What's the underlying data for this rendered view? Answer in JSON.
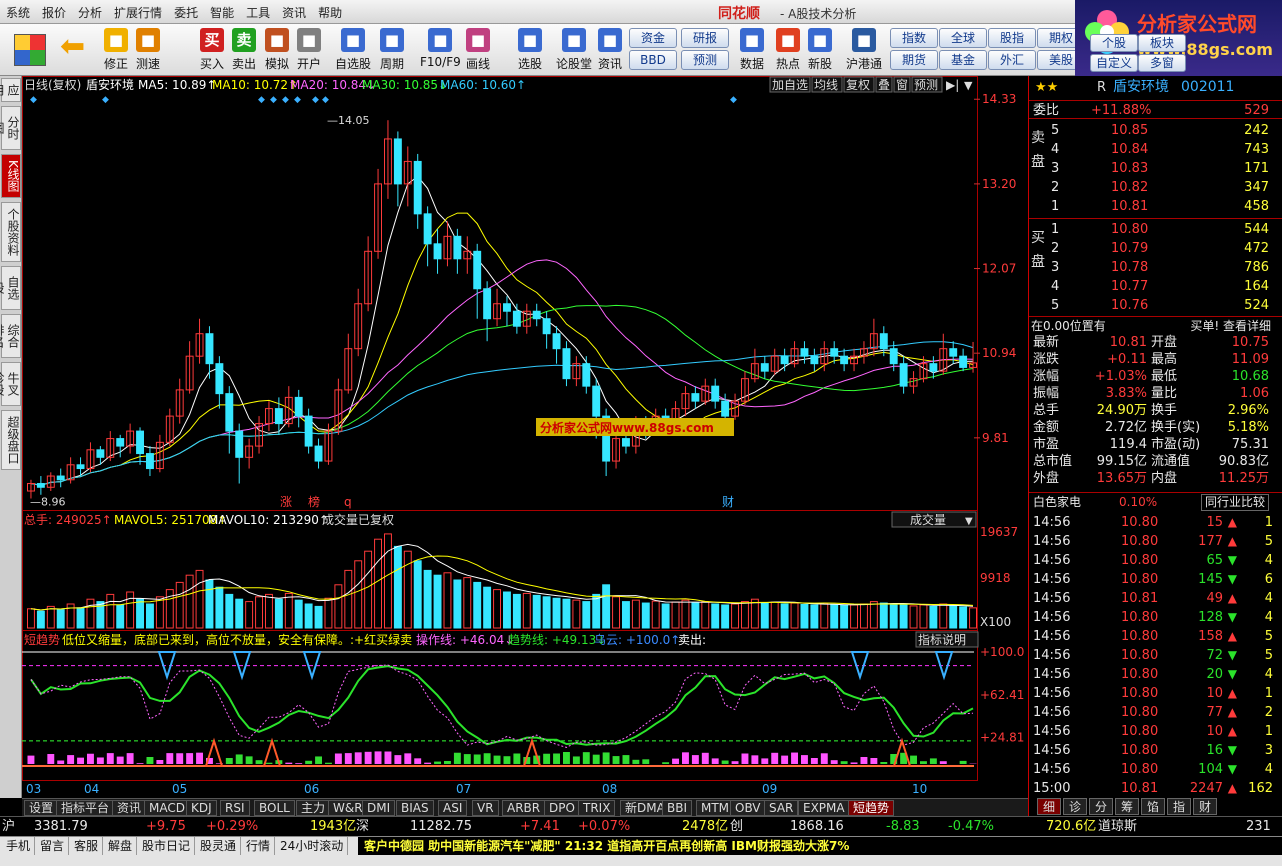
{
  "menu": [
    "系统",
    "报价",
    "分析",
    "扩展行情",
    "委托",
    "智能",
    "工具",
    "资讯",
    "帮助"
  ],
  "brand": "同花顺",
  "window_title": "- A股技术分析",
  "toolbar": [
    "修正",
    "测速",
    "买入",
    "卖出",
    "模拟",
    "开户",
    "自选股",
    "周期",
    "F10/F9",
    "画线",
    "选股",
    "论股堂",
    "资讯",
    "数据",
    "热点",
    "新股",
    "沪港通"
  ],
  "toolbar_icons": {
    "buy": "买",
    "sell": "卖"
  },
  "tool_btns": [
    [
      "资金",
      "BBD"
    ],
    [
      "研报",
      "预测"
    ],
    [
      "指数",
      "个股"
    ],
    [
      "全球",
      "板块"
    ],
    [
      "期货",
      "期货"
    ],
    [
      "期权",
      "基金"
    ],
    [
      "外汇",
      "自定义"
    ],
    [
      "美股",
      "多窗"
    ]
  ],
  "tool_btns2": [
    "指数",
    "全球",
    "股指",
    "期权",
    "个股",
    "板块",
    "期货",
    "基金",
    "外汇",
    "美股",
    "自定义",
    "多窗"
  ],
  "logo": {
    "line1": "分析家公式网",
    "line2": "www.88gs.com"
  },
  "left_tabs": [
    "应用",
    "分时图",
    "K线图",
    "个股资料",
    "自选股",
    "综合排名",
    "牛叉诊股",
    "超级盘口"
  ],
  "chart_header": {
    "prefix": "日线(复权)",
    "name": "盾安环境",
    "ma5": "MA5: 10.89↑",
    "ma10": "MA10: 10.72↑",
    "ma20": "MA20: 10.84↓",
    "ma30": "MA30: 10.85↓",
    "ma60": "MA60: 10.60↑"
  },
  "chart_header_btns": [
    "加自选",
    "均线",
    "复权",
    "叠",
    "窗",
    "预测"
  ],
  "price_axis": [
    "14.33",
    "13.20",
    "12.07",
    "10.94",
    "9.81"
  ],
  "price_marks": {
    "high": "14.05",
    "low": "8.96"
  },
  "markers": [
    "涨",
    "榜",
    "q",
    "财"
  ],
  "watermark": "分析家公式网www.88gs.com",
  "vol_header": {
    "label": "总手: 249025↑",
    "mavol5": "MAVOL5: 251708↑",
    "mavol10": "MAVOL10: 213290↑",
    "note": "成交量已复权"
  },
  "vol_select": "成交量",
  "vol_axis": [
    "19637",
    "9918",
    "X100"
  ],
  "ind_header": {
    "name": "短趋势",
    "desc": "低位又缩量，底部已来到，高位不放量，安全有保障。:+红买绿卖",
    "op": "操作线: +46.04↓",
    "trend": "趋势线: +49.13↓",
    "cloud": "乌云: +100.0↑",
    "out": "卖出:"
  },
  "ind_btn": "指标说明",
  "ind_axis": [
    "+100.0",
    "+62.41",
    "+24.81"
  ],
  "months": [
    "03",
    "04",
    "05",
    "06",
    "07",
    "08",
    "09",
    "10"
  ],
  "bottom_tabs": [
    "设置",
    "指标平台",
    "资讯",
    "MACD",
    "KDJ",
    "RSI",
    "BOLL",
    "主力",
    "W&R",
    "DMI",
    "BIAS",
    "ASI",
    "VR",
    "ARBR",
    "DPO",
    "TRIX",
    "新DMA",
    "BBI",
    "MTM",
    "OBV",
    "SAR",
    "EXPMA",
    "短趋势"
  ],
  "stock": {
    "prefix": "R",
    "name": "盾安环境",
    "code": "002011"
  },
  "weibi": {
    "label": "委比",
    "value": "+11.88%",
    "diff": "529"
  },
  "side_sell": "卖盘",
  "side_buy": "买盘",
  "asks": [
    [
      "5",
      "10.85",
      "242"
    ],
    [
      "4",
      "10.84",
      "743"
    ],
    [
      "3",
      "10.83",
      "171"
    ],
    [
      "2",
      "10.82",
      "347"
    ],
    [
      "1",
      "10.81",
      "458"
    ]
  ],
  "bids": [
    [
      "1",
      "10.80",
      "544"
    ],
    [
      "2",
      "10.79",
      "472"
    ],
    [
      "3",
      "10.78",
      "786"
    ],
    [
      "4",
      "10.77",
      "164"
    ],
    [
      "5",
      "10.76",
      "524"
    ]
  ],
  "pos_note": "在0.00位置有",
  "buy_note": "买单! 查看详细",
  "quote": [
    [
      "最新",
      "10.81",
      "开盘",
      "10.75"
    ],
    [
      "涨跌",
      "+0.11",
      "最高",
      "11.09"
    ],
    [
      "涨幅",
      "+1.03%",
      "最低",
      "10.68"
    ],
    [
      "振幅",
      "3.83%",
      "量比",
      "1.06"
    ],
    [
      "总手",
      "24.90万",
      "换手",
      "2.96%"
    ],
    [
      "金额",
      "2.72亿",
      "换手(实)",
      "5.18%"
    ],
    [
      "市盈",
      "119.4",
      "市盈(动)",
      "75.31"
    ],
    [
      "总市值",
      "99.15亿",
      "流通值",
      "90.83亿"
    ],
    [
      "外盘",
      "13.65万",
      "内盘",
      "11.25万"
    ]
  ],
  "industry": {
    "name": "白色家电",
    "pct": "0.10%",
    "btn": "同行业比较"
  },
  "ticks": [
    [
      "14:56",
      "10.80",
      "15",
      "up",
      "1"
    ],
    [
      "14:56",
      "10.80",
      "177",
      "up",
      "5"
    ],
    [
      "14:56",
      "10.80",
      "65",
      "dn",
      "4"
    ],
    [
      "14:56",
      "10.80",
      "145",
      "dn",
      "6"
    ],
    [
      "14:56",
      "10.81",
      "49",
      "up",
      "4"
    ],
    [
      "14:56",
      "10.80",
      "128",
      "dn",
      "4"
    ],
    [
      "14:56",
      "10.80",
      "158",
      "up",
      "5"
    ],
    [
      "14:56",
      "10.80",
      "72",
      "dn",
      "5"
    ],
    [
      "14:56",
      "10.80",
      "20",
      "dn",
      "4"
    ],
    [
      "14:56",
      "10.80",
      "10",
      "up",
      "1"
    ],
    [
      "14:56",
      "10.80",
      "77",
      "up",
      "2"
    ],
    [
      "14:56",
      "10.80",
      "10",
      "up",
      "1"
    ],
    [
      "14:56",
      "10.80",
      "16",
      "dn",
      "3"
    ],
    [
      "14:56",
      "10.80",
      "104",
      "dn",
      "4"
    ],
    [
      "15:00",
      "10.81",
      "2247",
      "up",
      "162"
    ]
  ],
  "rtabs": [
    "细",
    "诊",
    "分",
    "筹",
    "馅",
    "指",
    "财"
  ],
  "status": {
    "sh": "沪",
    "sh_val": "3381.79",
    "sh_chg": "+9.75",
    "sh_pct": "+0.29%",
    "sh_amt": "1943亿",
    "sz": "深",
    "sz_val": "11282.75",
    "sz_chg": "+7.41",
    "sz_pct": "+0.07%",
    "sz_amt": "2478亿",
    "cy": "创",
    "cy_val": "1868.16",
    "cy_chg": "-8.83",
    "cy_pct": "-0.47%",
    "cy_amt": "720.6亿",
    "dj": "道琼斯",
    "dj_val": "231"
  },
  "taskbar": [
    "手机",
    "留言",
    "客服",
    "解盘",
    "股市日记",
    "股灵通",
    "行情",
    "24小时滚动"
  ],
  "news1": "客户中德园 助中国新能源汽车\"减肥\"",
  "news2": "21:32 道指高开百点再创新高 IBM财报强劲大涨7%",
  "colors": {
    "up": "#ff3b3b",
    "down": "#2be32b",
    "ma5": "#ffffff",
    "ma10": "#ffff00",
    "ma20": "#ff66ff",
    "ma30": "#33ff33",
    "ma60": "#33ccff"
  },
  "chart_data": {
    "type": "candlestick",
    "ylim": [
      8.9,
      14.4
    ],
    "candles": [
      [
        9.1,
        9.2,
        9.25,
        9.0
      ],
      [
        9.2,
        9.15,
        9.3,
        9.05
      ],
      [
        9.15,
        9.3,
        9.35,
        9.1
      ],
      [
        9.3,
        9.25,
        9.4,
        9.15
      ],
      [
        9.25,
        9.45,
        9.55,
        9.2
      ],
      [
        9.45,
        9.4,
        9.55,
        9.3
      ],
      [
        9.4,
        9.65,
        9.75,
        9.35
      ],
      [
        9.65,
        9.55,
        9.7,
        9.45
      ],
      [
        9.55,
        9.8,
        9.9,
        9.5
      ],
      [
        9.8,
        9.7,
        9.85,
        9.55
      ],
      [
        9.7,
        9.9,
        10.0,
        9.6
      ],
      [
        9.9,
        9.6,
        9.95,
        9.45
      ],
      [
        9.6,
        9.4,
        9.7,
        9.3
      ],
      [
        9.4,
        9.75,
        9.85,
        9.35
      ],
      [
        9.75,
        10.1,
        10.2,
        9.7
      ],
      [
        10.1,
        10.45,
        10.6,
        10.0
      ],
      [
        10.45,
        10.9,
        11.1,
        10.4
      ],
      [
        10.9,
        11.2,
        11.4,
        10.8
      ],
      [
        11.2,
        10.8,
        11.3,
        10.6
      ],
      [
        10.8,
        10.4,
        10.9,
        10.2
      ],
      [
        10.4,
        9.9,
        10.5,
        9.6
      ],
      [
        9.9,
        9.55,
        10.0,
        9.2
      ],
      [
        9.55,
        9.7,
        9.8,
        9.4
      ],
      [
        9.7,
        10.0,
        10.1,
        9.6
      ],
      [
        10.0,
        10.2,
        10.3,
        9.9
      ],
      [
        10.2,
        10.0,
        10.35,
        9.85
      ],
      [
        10.0,
        10.35,
        10.5,
        9.95
      ],
      [
        10.35,
        10.1,
        10.45,
        9.95
      ],
      [
        10.1,
        9.7,
        10.2,
        9.6
      ],
      [
        9.7,
        9.5,
        9.8,
        9.4
      ],
      [
        9.5,
        9.9,
        10.0,
        9.45
      ],
      [
        9.9,
        10.45,
        10.6,
        9.85
      ],
      [
        10.45,
        11.0,
        11.2,
        10.4
      ],
      [
        11.0,
        11.6,
        11.8,
        10.9
      ],
      [
        11.6,
        12.3,
        12.5,
        11.5
      ],
      [
        12.3,
        13.2,
        13.4,
        12.2
      ],
      [
        13.2,
        13.8,
        14.05,
        13.0
      ],
      [
        13.8,
        13.2,
        13.9,
        12.9
      ],
      [
        13.2,
        13.5,
        13.7,
        12.9
      ],
      [
        13.5,
        12.8,
        13.6,
        12.6
      ],
      [
        12.8,
        12.4,
        12.9,
        12.1
      ],
      [
        12.4,
        12.2,
        12.6,
        12.0
      ],
      [
        12.2,
        12.5,
        12.7,
        12.1
      ],
      [
        12.5,
        12.2,
        12.6,
        12.0
      ],
      [
        12.2,
        12.3,
        12.5,
        12.0
      ],
      [
        12.3,
        11.8,
        12.4,
        11.4
      ],
      [
        11.8,
        11.4,
        11.9,
        11.1
      ],
      [
        11.4,
        11.6,
        11.8,
        11.3
      ],
      [
        11.6,
        11.5,
        11.7,
        11.3
      ],
      [
        11.5,
        11.3,
        11.6,
        11.2
      ],
      [
        11.3,
        11.5,
        11.6,
        11.2
      ],
      [
        11.5,
        11.4,
        11.6,
        11.3
      ],
      [
        11.4,
        11.2,
        11.5,
        11.0
      ],
      [
        11.2,
        11.0,
        11.3,
        10.8
      ],
      [
        11.0,
        10.6,
        11.1,
        10.5
      ],
      [
        10.6,
        10.8,
        10.9,
        10.5
      ],
      [
        10.8,
        10.5,
        10.9,
        10.4
      ],
      [
        10.5,
        10.1,
        10.6,
        9.8
      ],
      [
        10.1,
        9.5,
        10.2,
        9.3
      ],
      [
        9.5,
        9.8,
        9.9,
        9.4
      ],
      [
        9.8,
        9.7,
        9.9,
        9.6
      ],
      [
        9.7,
        10.0,
        10.1,
        9.6
      ],
      [
        10.0,
        9.9,
        10.1,
        9.8
      ],
      [
        9.9,
        10.1,
        10.2,
        9.85
      ],
      [
        10.1,
        10.0,
        10.2,
        9.9
      ],
      [
        10.0,
        10.2,
        10.3,
        9.95
      ],
      [
        10.2,
        10.4,
        10.5,
        10.1
      ],
      [
        10.4,
        10.3,
        10.5,
        10.2
      ],
      [
        10.3,
        10.5,
        10.6,
        10.25
      ],
      [
        10.5,
        10.3,
        10.6,
        10.2
      ],
      [
        10.3,
        10.1,
        10.4,
        10.0
      ],
      [
        10.1,
        10.3,
        10.4,
        10.05
      ],
      [
        10.3,
        10.6,
        10.7,
        10.25
      ],
      [
        10.6,
        10.8,
        11.0,
        10.55
      ],
      [
        10.8,
        10.7,
        10.9,
        10.6
      ],
      [
        10.7,
        10.9,
        11.0,
        10.65
      ],
      [
        10.9,
        10.8,
        11.0,
        10.7
      ],
      [
        10.8,
        11.0,
        11.1,
        10.75
      ],
      [
        11.0,
        10.9,
        11.1,
        10.8
      ],
      [
        10.9,
        10.8,
        11.0,
        10.7
      ],
      [
        10.8,
        11.0,
        11.1,
        10.7
      ],
      [
        11.0,
        10.9,
        11.1,
        10.8
      ],
      [
        10.9,
        10.8,
        11.0,
        10.7
      ],
      [
        10.8,
        10.9,
        11.0,
        10.7
      ],
      [
        10.9,
        11.0,
        11.1,
        10.8
      ],
      [
        11.0,
        11.2,
        11.4,
        10.9
      ],
      [
        11.2,
        11.0,
        11.3,
        10.9
      ],
      [
        11.0,
        10.8,
        11.1,
        10.7
      ],
      [
        10.8,
        10.5,
        10.9,
        10.4
      ],
      [
        10.5,
        10.6,
        10.7,
        10.4
      ],
      [
        10.6,
        10.8,
        10.9,
        10.55
      ],
      [
        10.8,
        10.7,
        10.9,
        10.6
      ],
      [
        10.7,
        11.0,
        11.2,
        10.65
      ],
      [
        11.0,
        10.9,
        11.1,
        10.8
      ],
      [
        10.9,
        10.75,
        11.0,
        10.7
      ],
      [
        10.75,
        10.81,
        11.09,
        10.68
      ]
    ],
    "volumes": [
      40,
      35,
      45,
      38,
      50,
      42,
      60,
      55,
      70,
      48,
      75,
      60,
      50,
      65,
      80,
      95,
      110,
      120,
      100,
      85,
      70,
      60,
      55,
      65,
      70,
      60,
      72,
      58,
      50,
      45,
      62,
      90,
      120,
      140,
      160,
      185,
      196,
      170,
      160,
      140,
      120,
      110,
      115,
      100,
      105,
      95,
      85,
      80,
      75,
      70,
      72,
      68,
      65,
      62,
      60,
      58,
      55,
      70,
      90,
      65,
      55,
      58,
      52,
      56,
      50,
      54,
      58,
      52,
      55,
      50,
      48,
      50,
      55,
      60,
      52,
      54,
      50,
      52,
      49,
      48,
      50,
      49,
      47,
      48,
      50,
      55,
      52,
      50,
      48,
      46,
      48,
      45,
      50,
      46,
      44,
      42
    ],
    "indicator_range": [
      0,
      100
    ]
  }
}
